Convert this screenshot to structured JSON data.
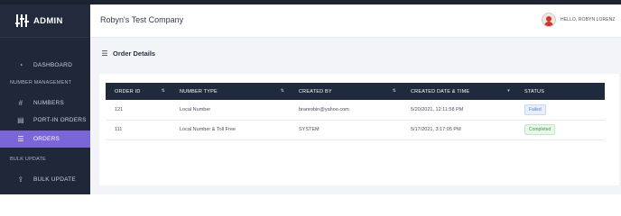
{
  "brand": {
    "label": "ADMIN"
  },
  "header": {
    "company": "Robyn's Test Company",
    "greeting": "HELLO, ROBYN LORENZ"
  },
  "sidebar": {
    "dashboard": "DASHBOARD",
    "section_number_management": "NUMBER MANAGEMENT",
    "numbers": "NUMBERS",
    "port_in_orders": "PORT-IN ORDERS",
    "orders": "ORDERS",
    "section_bulk_update": "BULK UPDATE",
    "bulk_update": "BULK UPDATE"
  },
  "main": {
    "title": "Order Details",
    "columns": [
      "ORDER ID",
      "NUMBER TYPE",
      "CREATED BY",
      "CREATED DATE & TIME",
      "STATUS"
    ],
    "rows": [
      {
        "order_id": "121",
        "number_type": "Local Number",
        "created_by": "branrobin@yahoo.com",
        "created": "5/20/2021, 12:11:58 PM",
        "status": "Failed"
      },
      {
        "order_id": "111",
        "number_type": "Local Number & Toll Free",
        "created_by": "SYSTEM",
        "created": "5/17/2021, 3:17:05 PM",
        "status": "Completed"
      }
    ]
  },
  "colors": {
    "sidebar": "#1f2738",
    "active": "#7a65d9",
    "table_header": "#1f2a3d"
  }
}
